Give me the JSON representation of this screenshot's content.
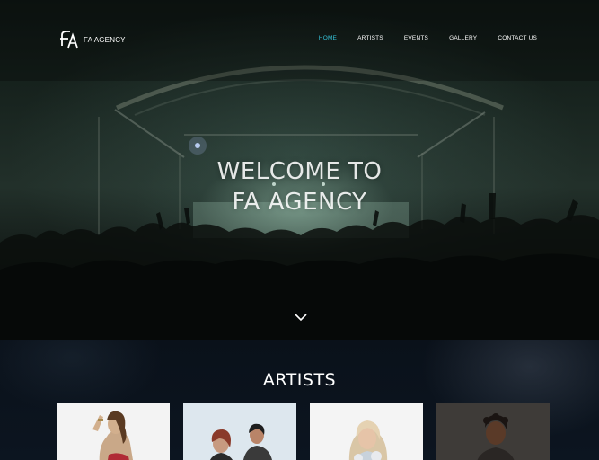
{
  "brand": {
    "name": "FA AGENCY",
    "logo_icon": "fa-monogram-logo"
  },
  "nav": {
    "items": [
      {
        "label": "HOME",
        "active": true
      },
      {
        "label": "ARTISTS",
        "active": false
      },
      {
        "label": "EVENTS",
        "active": false
      },
      {
        "label": "GALLERY",
        "active": false
      },
      {
        "label": "CONTACT US",
        "active": false
      }
    ]
  },
  "hero": {
    "title_line1": "WELCOME TO",
    "title_line2": "FA AGENCY",
    "scroll_icon": "chevron-down-icon"
  },
  "artists": {
    "title": "ARTISTS",
    "cards": [
      {
        "photo": "artist-photo-1"
      },
      {
        "photo": "artist-photo-2"
      },
      {
        "photo": "artist-photo-3"
      },
      {
        "photo": "artist-photo-4"
      }
    ]
  },
  "colors": {
    "accent": "#35c2d8",
    "text": "#ffffff",
    "background": "#0b121b"
  }
}
